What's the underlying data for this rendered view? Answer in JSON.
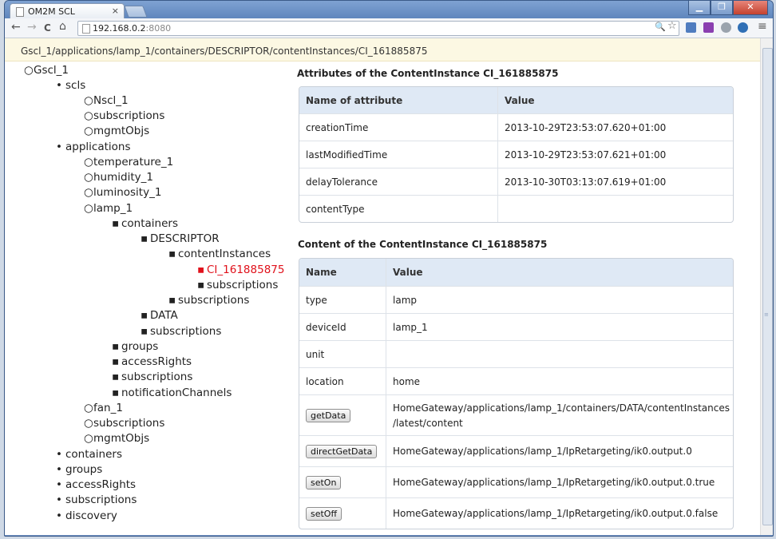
{
  "browser": {
    "tab_title": "OM2M SCL",
    "tab_close": "×",
    "url_host": "192.168.0.2",
    "url_port": ":8080",
    "window_min": "▁",
    "window_max": "❐",
    "window_close": "✕",
    "back": "←",
    "forward": "→",
    "reload": "C",
    "home": "⌂",
    "search_icon": "🔍",
    "star_icon": "☆",
    "menu_icon": "≡",
    "scroll_grip": "≡"
  },
  "breadcrumb": "Gscl_1/applications/lamp_1/containers/DESCRIPTOR/contentInstances/CI_161885875",
  "tree": [
    {
      "label": "Gscl_1",
      "bullet": "○"
    },
    {
      "label": "scls",
      "bullet": "•"
    },
    {
      "label": "Nscl_1",
      "bullet": "○"
    },
    {
      "label": "subscriptions",
      "bullet": "○"
    },
    {
      "label": "mgmtObjs",
      "bullet": "○"
    },
    {
      "label": "applications",
      "bullet": "•"
    },
    {
      "label": "temperature_1",
      "bullet": "○"
    },
    {
      "label": "humidity_1",
      "bullet": "○"
    },
    {
      "label": "luminosity_1",
      "bullet": "○"
    },
    {
      "label": "lamp_1",
      "bullet": "○"
    },
    {
      "label": "containers",
      "bullet": "▪"
    },
    {
      "label": "DESCRIPTOR",
      "bullet": "▪"
    },
    {
      "label": "contentInstances",
      "bullet": "▪"
    },
    {
      "label": "CI_161885875",
      "bullet": "▪"
    },
    {
      "label": "subscriptions",
      "bullet": "▪"
    },
    {
      "label": "subscriptions",
      "bullet": "▪"
    },
    {
      "label": "DATA",
      "bullet": "▪"
    },
    {
      "label": "subscriptions",
      "bullet": "▪"
    },
    {
      "label": "groups",
      "bullet": "▪"
    },
    {
      "label": "accessRights",
      "bullet": "▪"
    },
    {
      "label": "subscriptions",
      "bullet": "▪"
    },
    {
      "label": "notificationChannels",
      "bullet": "▪"
    },
    {
      "label": "fan_1",
      "bullet": "○"
    },
    {
      "label": "subscriptions",
      "bullet": "○"
    },
    {
      "label": "mgmtObjs",
      "bullet": "○"
    },
    {
      "label": "containers",
      "bullet": "•"
    },
    {
      "label": "groups",
      "bullet": "•"
    },
    {
      "label": "accessRights",
      "bullet": "•"
    },
    {
      "label": "subscriptions",
      "bullet": "•"
    },
    {
      "label": "discovery",
      "bullet": "•"
    }
  ],
  "attributes": {
    "title": "Attributes of the ContentInstance CI_161885875",
    "col1": "Name of attribute",
    "col2": "Value",
    "rows": [
      {
        "name": "creationTime",
        "value": "2013-10-29T23:53:07.620+01:00"
      },
      {
        "name": "lastModifiedTime",
        "value": "2013-10-29T23:53:07.621+01:00"
      },
      {
        "name": "delayTolerance",
        "value": "2013-10-30T03:13:07.619+01:00"
      },
      {
        "name": "contentType",
        "value": ""
      }
    ]
  },
  "content": {
    "title": "Content of the ContentInstance CI_161885875",
    "col1": "Name",
    "col2": "Value",
    "rows": [
      {
        "name": "type",
        "value": "lamp"
      },
      {
        "name": "deviceId",
        "value": "lamp_1"
      },
      {
        "name": "unit",
        "value": ""
      },
      {
        "name": "location",
        "value": "home"
      }
    ],
    "ops": [
      {
        "label": "getData",
        "value1": "HomeGateway/applications/lamp_1/containers/DATA/contentInstances",
        "value2": "/latest/content"
      },
      {
        "label": "directGetData",
        "value1": "HomeGateway/applications/lamp_1/IpRetargeting/ik0.output.0",
        "value2": ""
      },
      {
        "label": "setOn",
        "value1": "HomeGateway/applications/lamp_1/IpRetargeting/ik0.output.0.true",
        "value2": ""
      },
      {
        "label": "setOff",
        "value1": "HomeGateway/applications/lamp_1/IpRetargeting/ik0.output.0.false",
        "value2": ""
      }
    ]
  }
}
